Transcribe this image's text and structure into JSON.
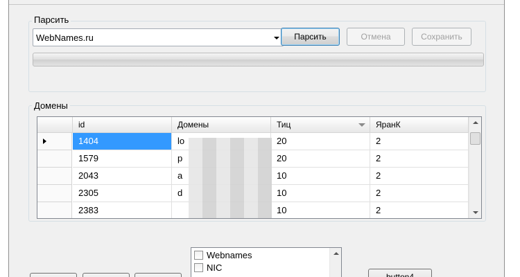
{
  "parse_group": {
    "caption": "Парсить",
    "source_combo_value": "WebNames.ru",
    "parse_button": "Парсить",
    "cancel_button": "Отмена",
    "save_button": "Сохранить"
  },
  "domains_group": {
    "caption": "Домены",
    "columns": [
      "id",
      "Домены",
      "Тиц",
      "ЯранК"
    ],
    "rows": [
      {
        "id": "1404",
        "domain": "lo",
        "tic": "20",
        "rank": "2"
      },
      {
        "id": "1579",
        "domain": "p",
        "tic": "20",
        "rank": "2"
      },
      {
        "id": "2043",
        "domain": "a",
        "tic": "10",
        "rank": "2"
      },
      {
        "id": "2305",
        "domain": "d",
        "tic": "10",
        "rank": "2"
      },
      {
        "id": "2383",
        "domain": "",
        "tic": "10",
        "rank": "2"
      }
    ]
  },
  "sources_list": {
    "items": [
      "Webnames",
      "NIC"
    ]
  },
  "bottom_buttons": {
    "button4": "button4"
  }
}
